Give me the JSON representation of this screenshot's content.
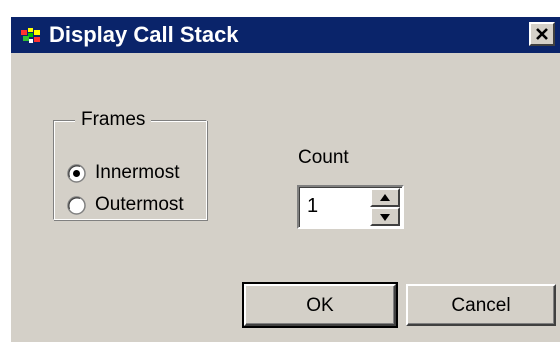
{
  "window": {
    "title": "Display Call Stack",
    "icon": "app-icon",
    "close_icon": "close-icon"
  },
  "frames": {
    "legend": "Frames",
    "options": [
      {
        "label": "Innermost",
        "selected": true
      },
      {
        "label": "Outermost",
        "selected": false
      }
    ]
  },
  "count": {
    "label": "Count",
    "value": "1",
    "up_icon": "arrow-up-icon",
    "down_icon": "arrow-down-icon"
  },
  "buttons": {
    "ok_label": "OK",
    "cancel_label": "Cancel"
  },
  "colors": {
    "titlebar": "#0a246a",
    "face": "#d4d0c8"
  }
}
